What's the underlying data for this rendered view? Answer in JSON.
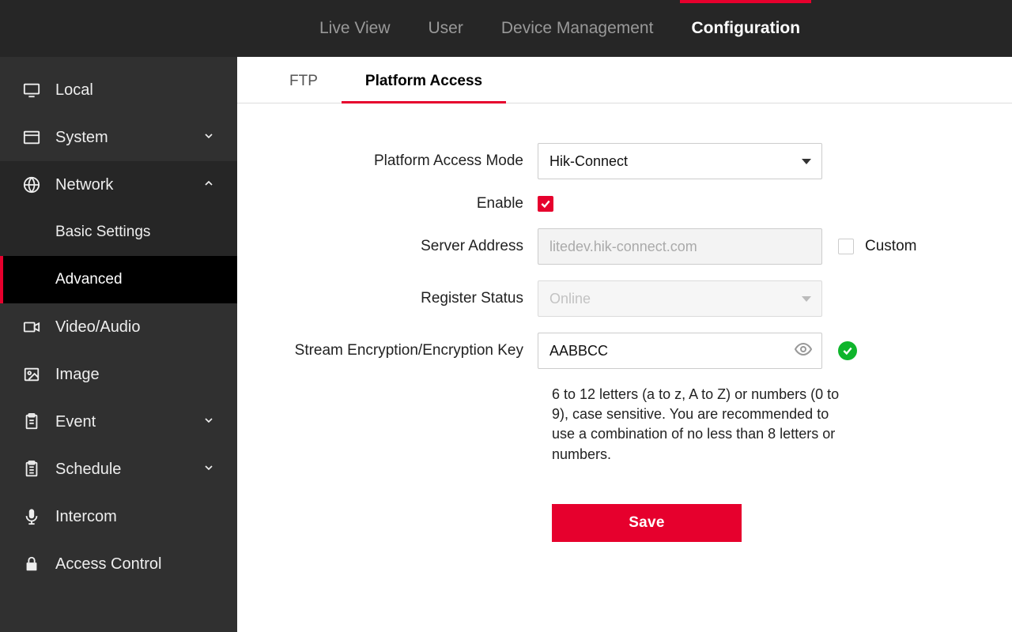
{
  "topnav": {
    "items": [
      {
        "label": "Live View"
      },
      {
        "label": "User"
      },
      {
        "label": "Device Management"
      },
      {
        "label": "Configuration"
      }
    ],
    "active": 3
  },
  "sidebar": {
    "local": "Local",
    "system": "System",
    "network": "Network",
    "network_sub": {
      "basic": "Basic Settings",
      "advanced": "Advanced"
    },
    "video_audio": "Video/Audio",
    "image": "Image",
    "event": "Event",
    "schedule": "Schedule",
    "intercom": "Intercom",
    "access_control": "Access Control"
  },
  "tabs": {
    "ftp": "FTP",
    "platform_access": "Platform Access"
  },
  "form": {
    "platform_access_mode_label": "Platform Access Mode",
    "platform_access_mode_value": "Hik-Connect",
    "enable_label": "Enable",
    "enable_checked": true,
    "server_address_label": "Server Address",
    "server_address_value": "litedev.hik-connect.com",
    "custom_label": "Custom",
    "register_status_label": "Register Status",
    "register_status_value": "Online",
    "encryption_label": "Stream Encryption/Encryption Key",
    "encryption_value": "AABBCC",
    "hint": "6 to 12 letters (a to z, A to Z) or numbers (0 to 9), case sensitive. You are recommended to use a combination of no less than 8 letters or numbers.",
    "save_label": "Save"
  }
}
